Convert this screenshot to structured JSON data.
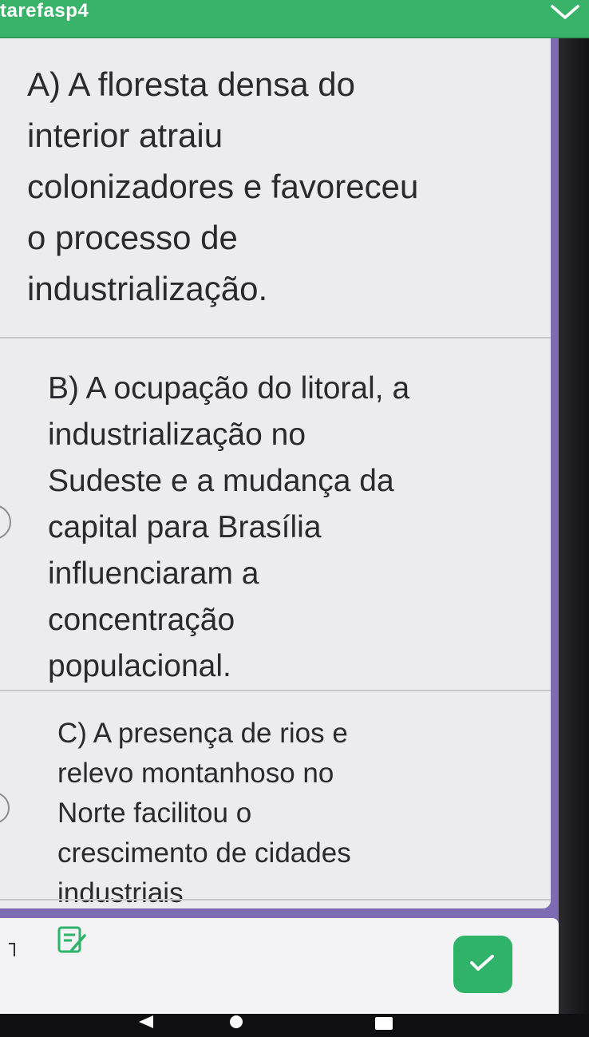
{
  "app": {
    "title": "tarefasp4"
  },
  "options": [
    {
      "id": "A",
      "text": "A) A floresta densa do\ninterior atraiu\ncolonizadores e favoreceu\no processo de\nindustrialização."
    },
    {
      "id": "B",
      "text": "B) A ocupação do litoral, a\nindustrialização no\nSudeste e a mudança da\ncapital para Brasília\ninfluenciaram a\nconcentração\npopulacional."
    },
    {
      "id": "C",
      "text": "C) A presença de rios e\nrelevo montanhoso no\nNorte facilitou o\ncrescimento de cidades\nindustriais"
    }
  ],
  "icons": {
    "top_right": "chevron-down-icon",
    "notes": "notes-icon",
    "confirm": "check-icon"
  },
  "colors": {
    "header": "#39b26a",
    "background": "#7d6bb4",
    "card": "#ecebee",
    "confirm_button": "#2fb36a"
  }
}
